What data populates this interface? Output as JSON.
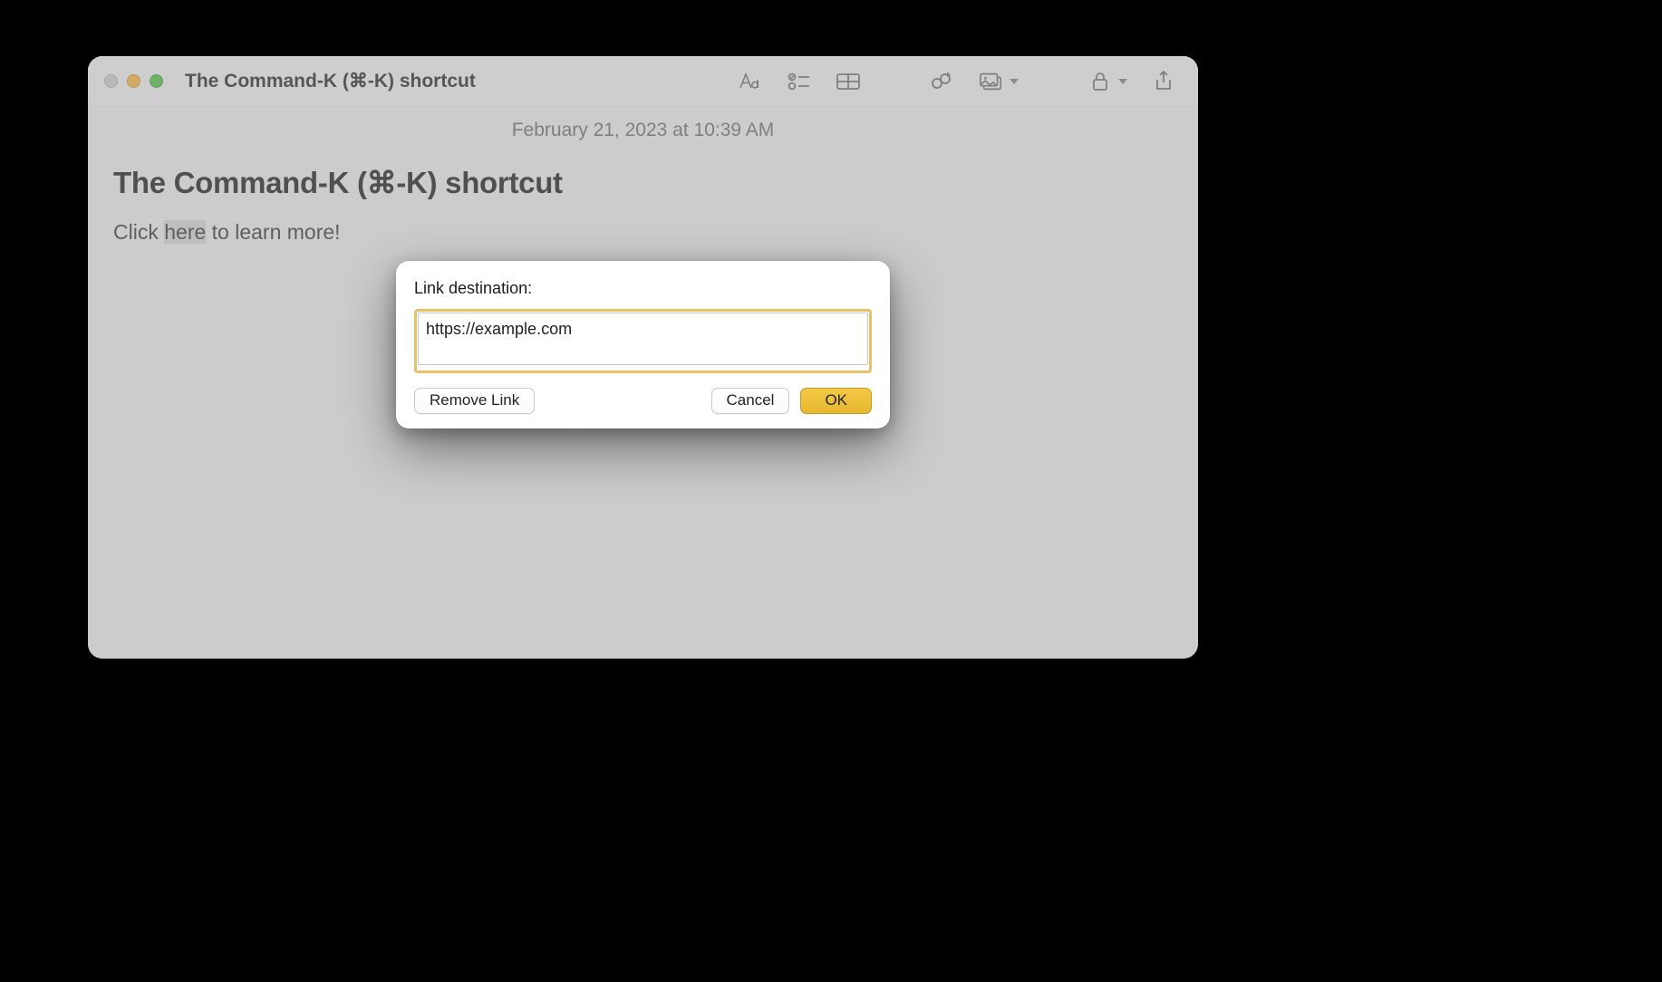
{
  "window": {
    "title": "The Command-K (⌘-K) shortcut"
  },
  "note": {
    "date": "February 21, 2023 at 10:39 AM",
    "title": "The Command-K (⌘-K) shortcut",
    "body_prefix": "Click ",
    "body_selected": "here",
    "body_suffix": " to learn more!"
  },
  "dialog": {
    "label": "Link destination:",
    "url": "https://example.com",
    "remove": "Remove Link",
    "cancel": "Cancel",
    "ok": "OK"
  },
  "toolbar": {
    "format": "format-icon",
    "checklist": "checklist-icon",
    "table": "table-icon",
    "link": "link-icon",
    "media": "media-icon",
    "lock": "lock-icon",
    "share": "share-icon"
  }
}
